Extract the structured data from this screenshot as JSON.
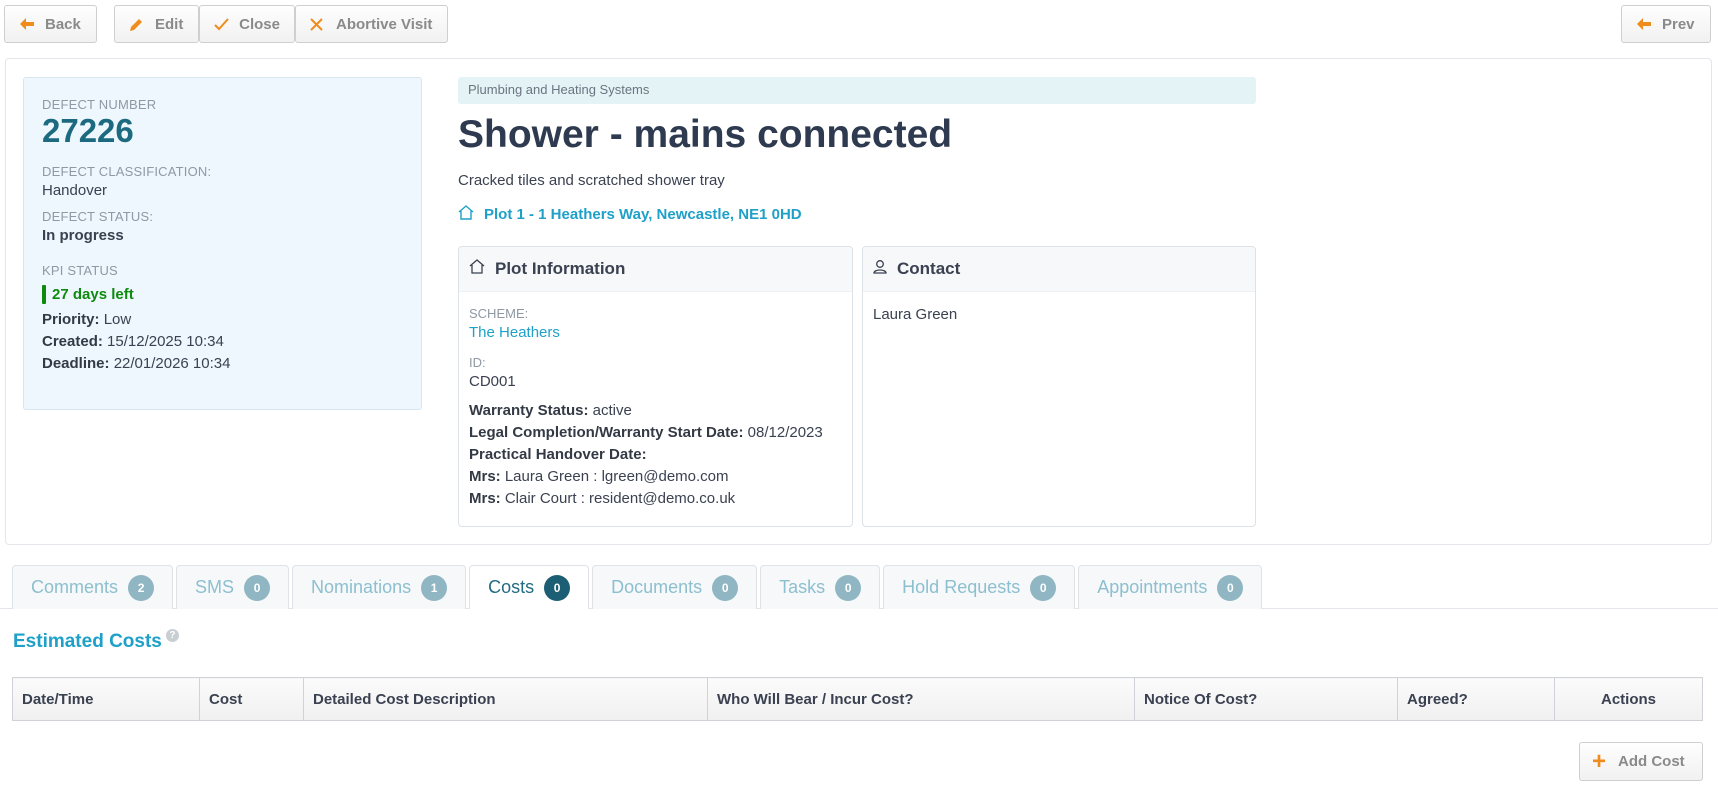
{
  "toolbar": {
    "back": "Back",
    "edit": "Edit",
    "close": "Close",
    "abortive": "Abortive Visit",
    "prev": "Prev"
  },
  "summary": {
    "defect_number_label": "DEFECT NUMBER",
    "defect_number": "27226",
    "classification_label": "DEFECT CLASSIFICATION:",
    "classification": "Handover",
    "status_label": "DEFECT STATUS:",
    "status": "In progress",
    "kpi_label": "KPI STATUS",
    "kpi_value": "27 days left",
    "kpi_color": "#0f8a0f",
    "priority_label": "Priority:",
    "priority": "Low",
    "created_label": "Created:",
    "created": "15/12/2025 10:34",
    "deadline_label": "Deadline:",
    "deadline": "22/01/2026 10:34"
  },
  "defect": {
    "category": "Plumbing and Heating Systems",
    "title": "Shower - mains connected",
    "description": "Cracked tiles and scratched shower tray",
    "address": "Plot 1 - 1 Heathers Way, Newcastle, NE1 0HD",
    "address_icon": "home-icon"
  },
  "plot": {
    "header": "Plot Information",
    "scheme_label": "SCHEME:",
    "scheme": "The Heathers",
    "id_label": "ID:",
    "id": "CD001",
    "warranty_label": "Warranty Status:",
    "warranty": "active",
    "legal_label": "Legal Completion/Warranty Start Date:",
    "legal": "08/12/2023",
    "handover_label": "Practical Handover Date:",
    "resident1_title": "Mrs:",
    "resident1": "Laura Green : lgreen@demo.com",
    "resident2_title": "Mrs:",
    "resident2": "Clair Court : resident@demo.co.uk"
  },
  "contact": {
    "header": "Contact",
    "name": "Laura Green"
  },
  "tabs": [
    {
      "label": "Comments",
      "count": "2"
    },
    {
      "label": "SMS",
      "count": "0"
    },
    {
      "label": "Nominations",
      "count": "1"
    },
    {
      "label": "Costs",
      "count": "0"
    },
    {
      "label": "Documents",
      "count": "0"
    },
    {
      "label": "Tasks",
      "count": "0"
    },
    {
      "label": "Hold Requests",
      "count": "0"
    },
    {
      "label": "Appointments",
      "count": "0"
    }
  ],
  "active_tab": "Costs",
  "costs": {
    "title": "Estimated Costs",
    "help": "?",
    "columns": [
      "Date/Time",
      "Cost",
      "Detailed Cost Description",
      "Who Will Bear / Incur Cost?",
      "Notice Of Cost?",
      "Agreed?",
      "Actions"
    ],
    "add_label": "Add Cost"
  },
  "colors": {
    "accent": "#1ea0c8",
    "brand_dark": "#1c6a80",
    "orange": "#f08c1c"
  }
}
